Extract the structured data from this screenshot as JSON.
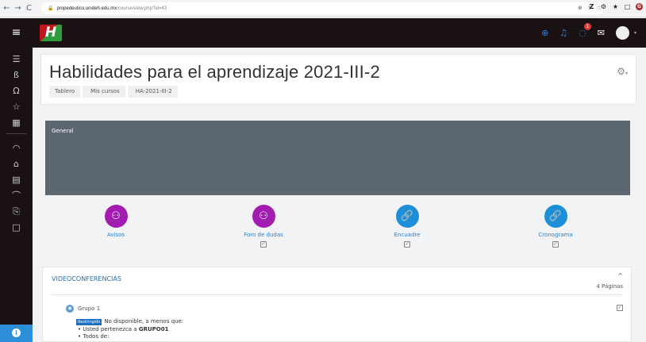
{
  "browser": {
    "back": "←",
    "forward": "→",
    "reload": "C",
    "url_host": "propedeutico.unideh.edu.mx",
    "url_path": "/course/view.php?id=43",
    "extensions": [
      "Z",
      "⚙",
      "★",
      "□",
      "G"
    ]
  },
  "navbar": {
    "logo": "H",
    "notification_count": "1"
  },
  "course": {
    "title": "Habilidades para el aprendizaje 2021-III-2",
    "breadcrumb": [
      "Tablero",
      "Mis cursos",
      "HA-2021-III-2"
    ]
  },
  "general": {
    "title": "General"
  },
  "activities": [
    {
      "label": "Avisos",
      "color": "purple",
      "icon": "forum-icon",
      "glyph": "⚇",
      "check": false
    },
    {
      "label": "Foro de dudas",
      "color": "purple",
      "icon": "forum-icon",
      "glyph": "⚇",
      "check": true
    },
    {
      "label": "Encuadre",
      "color": "blue",
      "icon": "url-link-icon",
      "glyph": "🔗",
      "check": true
    },
    {
      "label": "Cronograma",
      "color": "blue",
      "icon": "url-link-icon",
      "glyph": "🔗",
      "check": true
    }
  ],
  "videoconferencias": {
    "title": "VIDEOCONFERENCIAS",
    "pages": "4 Páginas",
    "group_name": "Grupo 1",
    "restriction_tag": "Restringido",
    "restriction_text": "No disponible, a menos que:",
    "conditions": [
      {
        "text": "Usted pertenezca a ",
        "bold": "GRUPO01"
      },
      {
        "text": "Todos de:",
        "bold": ""
      }
    ]
  },
  "colors": {
    "navbar": "#1a1212",
    "purple_activity": "#a21caf",
    "blue_activity": "#1d8fd8",
    "general_banner": "#5d6771",
    "link": "#2a7fc7"
  }
}
